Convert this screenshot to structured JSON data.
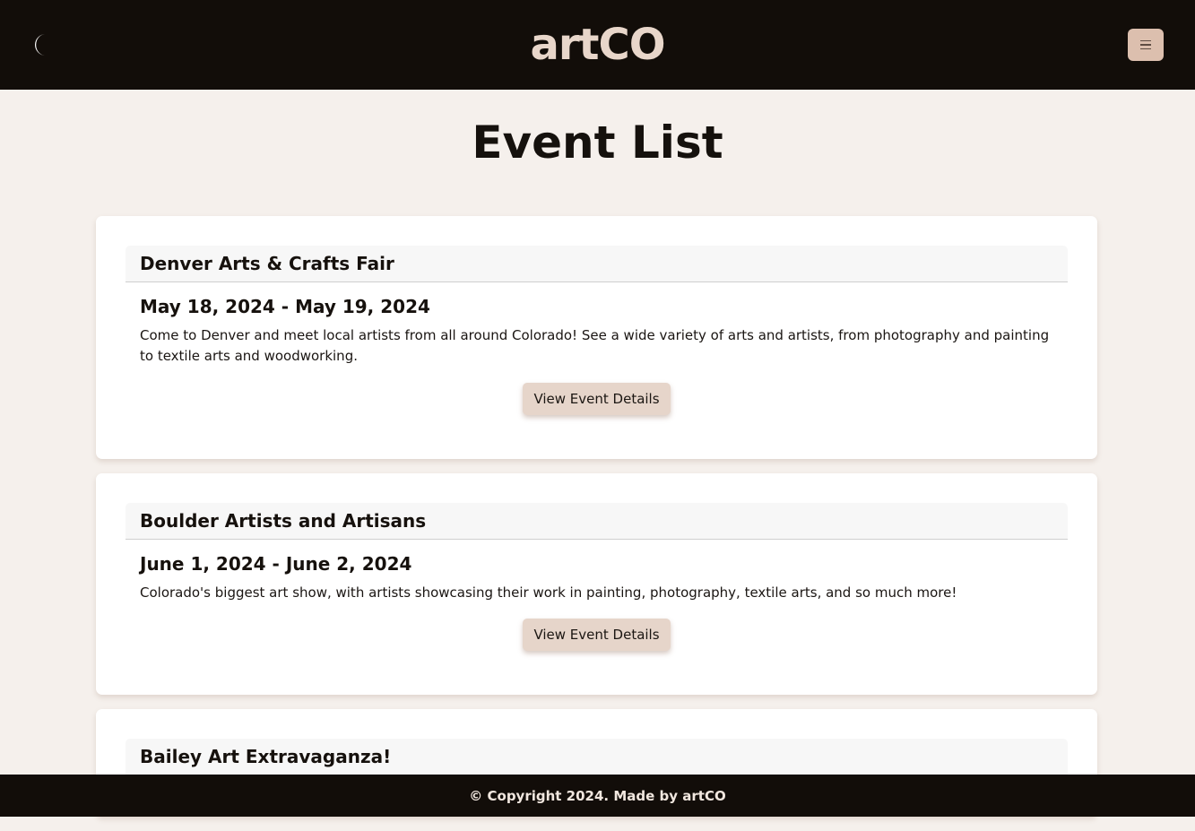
{
  "navbar": {
    "brand": "artCO",
    "theme_icon": "moon-icon",
    "menu_icon": "hamburger-menu-icon"
  },
  "page": {
    "title": "Event List"
  },
  "events": [
    {
      "title": "Denver Arts & Crafts Fair",
      "dates": "May 18, 2024 - May 19, 2024",
      "description": "Come to Denver and meet local artists from all around Colorado! See a wide variety of arts and artists, from photography and painting to textile arts and woodworking.",
      "button_label": "View Event Details"
    },
    {
      "title": "Boulder Artists and Artisans",
      "dates": "June 1, 2024 - June 2, 2024",
      "description": "Colorado's biggest art show, with artists showcasing their work in painting, photography, textile arts, and so much more!",
      "button_label": "View Event Details"
    },
    {
      "title": "Bailey Art Extravaganza!"
    }
  ],
  "footer": {
    "text": "© Copyright 2024. Made by artCO"
  },
  "colors": {
    "navbar_bg": "#120d09",
    "brand": "#e8d6ca",
    "page_bg": "#f5f0ec",
    "button_bg": "#e6d5ca",
    "menu_button_bg": "#dcbfae"
  }
}
